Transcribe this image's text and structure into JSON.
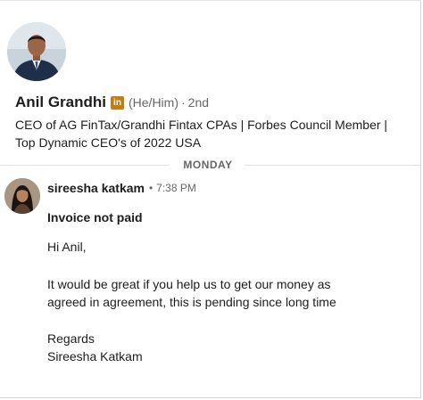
{
  "profile": {
    "name": "Anil Grandhi",
    "badge": "in",
    "pronouns": "(He/Him)",
    "separator": "·",
    "degree": "2nd",
    "headline": "CEO of AG FinTax/Grandhi Fintax CPAs | Forbes Council Member | Top Dynamic CEO's of 2022 USA",
    "avatar_icon": "profile-photo"
  },
  "divider": {
    "label": "MONDAY"
  },
  "message": {
    "sender": "sireesha katkam",
    "separator": "•",
    "time": "7:38 PM",
    "subject": "Invoice not paid",
    "greeting": "Hi Anil,",
    "body_line1": "It would be great if you help us to get our money as",
    "body_line2": "agreed in agreement, this is pending since long time",
    "closing": "Regards",
    "signature": "Sireesha Katkam",
    "avatar_icon": "sender-photo"
  },
  "colors": {
    "badge": "#c37d16",
    "text": "#1d1d1d",
    "muted": "#666666",
    "divider": "#e2e2e2"
  }
}
